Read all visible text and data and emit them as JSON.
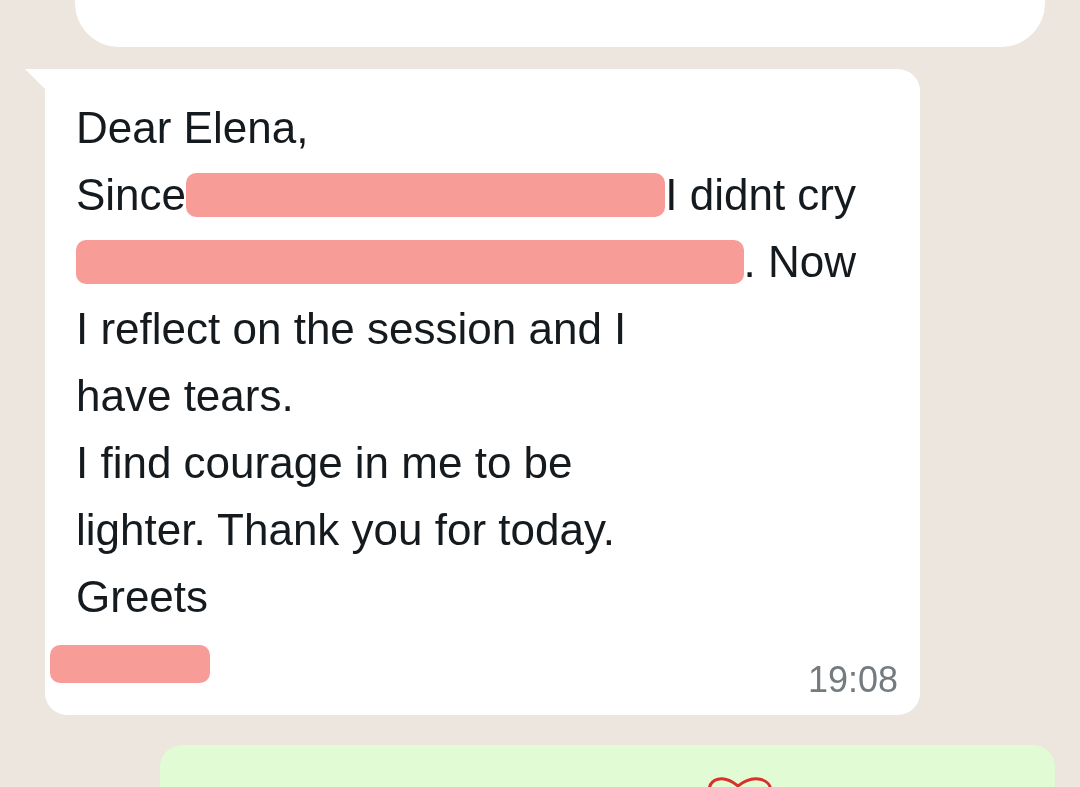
{
  "messages": [
    {
      "kind": "incoming"
    },
    {
      "kind": "incoming",
      "lines": [
        {
          "segments": [
            {
              "kind": "text",
              "text": "Dear Elena,"
            }
          ]
        },
        {
          "segments": [
            {
              "kind": "text",
              "text": "Since"
            },
            {
              "kind": "redaction"
            },
            {
              "kind": "text",
              "text": "I didnt cry"
            }
          ]
        },
        {
          "segments": [
            {
              "kind": "redaction"
            },
            {
              "kind": "text",
              "text": ". Now"
            }
          ]
        },
        {
          "segments": [
            {
              "kind": "text",
              "text": "I reflect on the session and I"
            }
          ]
        },
        {
          "segments": [
            {
              "kind": "text",
              "text": "have tears."
            }
          ]
        },
        {
          "segments": [
            {
              "kind": "text",
              "text": "I find courage in me to be"
            }
          ]
        },
        {
          "segments": [
            {
              "kind": "text",
              "text": "lighter. Thank you for today."
            }
          ]
        },
        {
          "segments": [
            {
              "kind": "text",
              "text": "Greets"
            }
          ]
        },
        {
          "segments": [
            {
              "kind": "redaction"
            }
          ]
        }
      ],
      "time": "19:08"
    },
    {
      "kind": "outgoing",
      "lines": [
        {
          "segments": [
            {
              "kind": "emoji"
            }
          ]
        }
      ]
    }
  ]
}
